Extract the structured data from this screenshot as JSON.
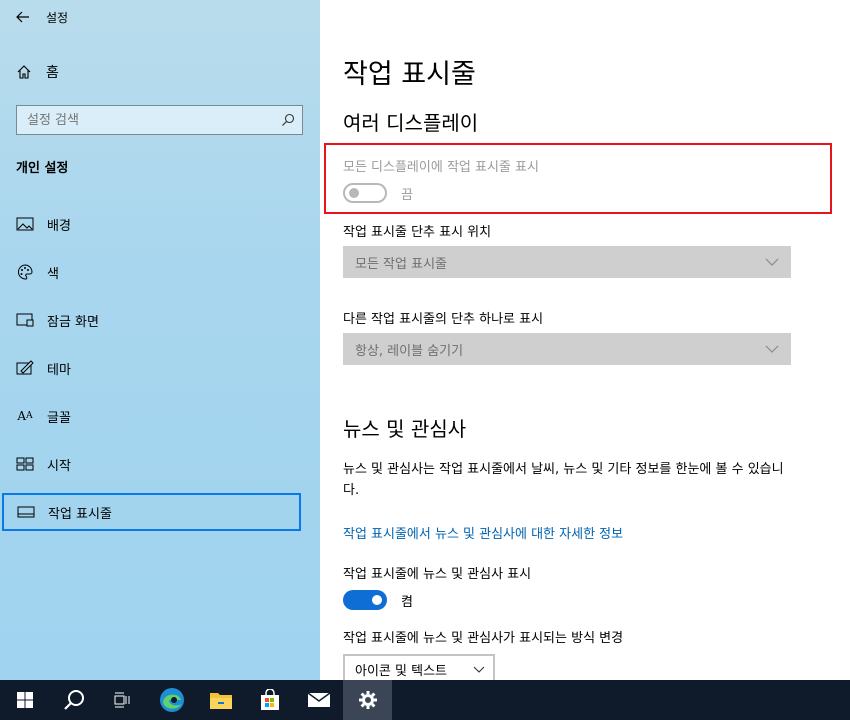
{
  "window": {
    "title": "설정"
  },
  "sidebar": {
    "home_label": "홈",
    "search_placeholder": "설정 검색",
    "section_title": "개인 설정",
    "items": [
      {
        "label": "배경",
        "icon": "picture-icon"
      },
      {
        "label": "색",
        "icon": "palette-icon"
      },
      {
        "label": "잠금 화면",
        "icon": "lock-screen-icon"
      },
      {
        "label": "테마",
        "icon": "theme-icon"
      },
      {
        "label": "글꼴",
        "icon": "font-icon"
      },
      {
        "label": "시작",
        "icon": "start-icon"
      },
      {
        "label": "작업 표시줄",
        "icon": "taskbar-icon",
        "selected": true
      }
    ]
  },
  "main": {
    "page_title": "작업 표시줄",
    "multi_display": {
      "heading": "여러 디스플레이",
      "show_all_label": "모든 디스플레이에 작업 표시줄 표시",
      "show_all_state": "끔",
      "buttons_location_label": "작업 표시줄 단추 표시 위치",
      "buttons_location_value": "모든 작업 표시줄",
      "combine_label": "다른 작업 표시줄의 단추 하나로 표시",
      "combine_value": "항상, 레이블 숨기기"
    },
    "news": {
      "heading": "뉴스 및 관심사",
      "description": "뉴스 및 관심사는 작업 표시줄에서 날씨, 뉴스 및 기타 정보를 한눈에 볼 수 있습니다.",
      "link": "작업 표시줄에서 뉴스 및 관심사에 대한 자세한 정보",
      "show_label": "작업 표시줄에 뉴스 및 관심사 표시",
      "show_state": "켬",
      "mode_label": "작업 표시줄에 뉴스 및 관심사가 표시되는 방식 변경",
      "mode_value": "아이콘 및 텍스트"
    }
  },
  "taskbar": {
    "items": [
      "start-icon",
      "search-icon",
      "task-view-icon",
      "edge-icon",
      "file-explorer-icon",
      "store-icon",
      "mail-icon",
      "settings-icon"
    ],
    "active": "settings-icon"
  },
  "colors": {
    "accent": "#0f6dd6",
    "highlight": "#e8141c",
    "selection": "#0a7ae8"
  }
}
